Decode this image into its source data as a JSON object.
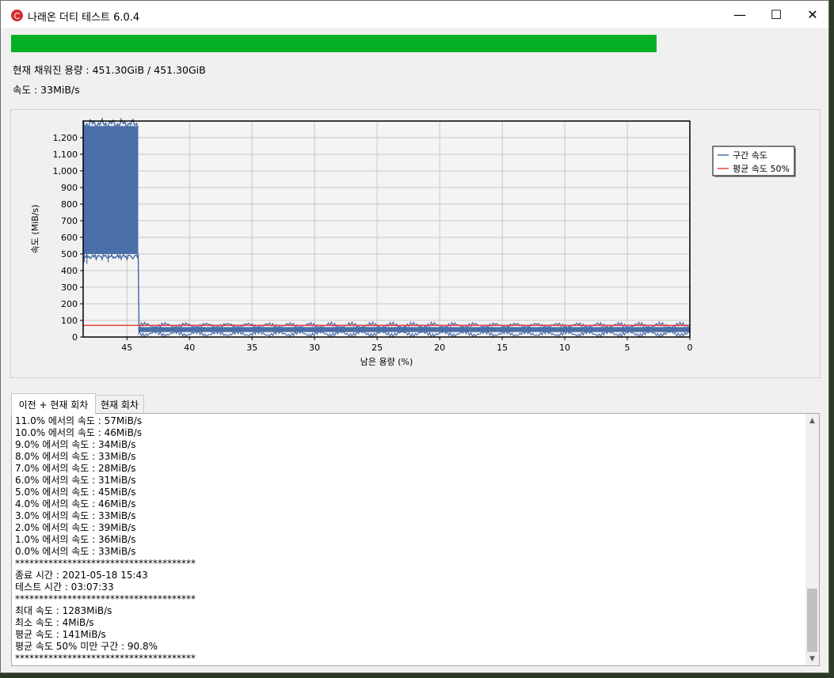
{
  "window": {
    "title": "나래온 더티 테스트 6.0.4",
    "minimize_symbol": "—",
    "maximize_symbol": "☐",
    "close_symbol": "✕"
  },
  "progress": {
    "fraction": 1.0,
    "color": "#06b025"
  },
  "status": {
    "capacity_text": "현재 채워진 용량 : 451.30GiB / 451.30GiB",
    "speed_text": "속도 : 33MiB/s"
  },
  "chart_data": {
    "type": "line",
    "xlabel": "남은 용량 (%)",
    "ylabel": "속도 (MiB/s)",
    "xlim": [
      48.5,
      0
    ],
    "ylim": [
      0,
      1300
    ],
    "x_ticks": [
      45,
      40,
      35,
      30,
      25,
      20,
      15,
      10,
      5,
      0
    ],
    "y_ticks": [
      0,
      100,
      200,
      300,
      400,
      500,
      600,
      700,
      800,
      900,
      1000,
      1100,
      1200
    ],
    "grid": true,
    "legend_position": "right",
    "series": [
      {
        "name": "구간 속도",
        "color": "#4a6ea8",
        "segments": [
          {
            "x_from": 48.5,
            "x_to": 44.1,
            "low": 500,
            "high": 1270,
            "spikes_low": [
              450,
              440,
              510,
              850
            ]
          },
          {
            "x_from": 44.1,
            "x_to": 0,
            "low": 30,
            "high": 60
          }
        ]
      },
      {
        "name": "평균 속도 50%",
        "color": "#e8423f",
        "value": 70
      }
    ]
  },
  "tabs": [
    {
      "label": "이전 + 현재 회차",
      "active": true
    },
    {
      "label": "현재 회차",
      "active": false
    }
  ],
  "log": {
    "lines": [
      "11.0% 에서의 속도 : 57MiB/s",
      "10.0% 에서의 속도 : 46MiB/s",
      "9.0% 에서의 속도 : 34MiB/s",
      "8.0% 에서의 속도 : 33MiB/s",
      "7.0% 에서의 속도 : 28MiB/s",
      "6.0% 에서의 속도 : 31MiB/s",
      "5.0% 에서의 속도 : 45MiB/s",
      "4.0% 에서의 속도 : 46MiB/s",
      "3.0% 에서의 속도 : 33MiB/s",
      "2.0% 에서의 속도 : 39MiB/s",
      "1.0% 에서의 속도 : 36MiB/s",
      "0.0% 에서의 속도 : 33MiB/s",
      "**************************************",
      "종료 시간 : 2021-05-18 15:43",
      "테스트 시간 : 03:07:33",
      "**************************************",
      "최대 속도 : 1283MiB/s",
      "최소 속도 : 4MiB/s",
      "평균 속도 : 141MiB/s",
      "평균 속도 50% 미만 구간 : 90.8%",
      "**************************************"
    ]
  }
}
